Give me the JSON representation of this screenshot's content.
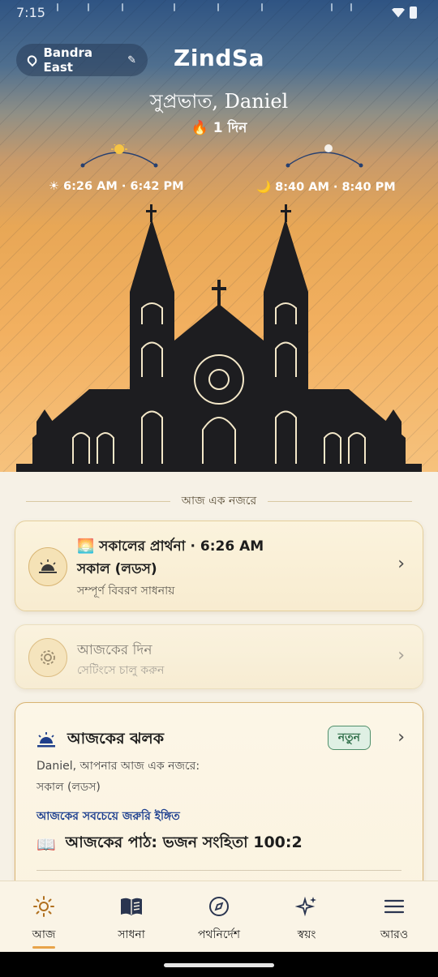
{
  "status_bar": {
    "time": "7:15"
  },
  "header": {
    "location": "Bandra East",
    "app_title": "ZindSa",
    "greeting": "সুপ্রভাত, Daniel",
    "streak": "🔥 1 দিন",
    "sun_times": "☀ 6:26 AM · 6:42 PM",
    "moon_times": "🌙 8:40 AM · 8:40 PM"
  },
  "glance": {
    "title": "আজ এক নজরে"
  },
  "prayer_card": {
    "title": "🌅 সকালের প্রার্থনা · 6:26 AM",
    "name": "সকাল (লডস)",
    "subtitle": "সম্পূর্ণ বিবরণ সাধনায়"
  },
  "today_card": {
    "title": "আজকের দিন",
    "subtitle": "সেটিংসে চালু করুন"
  },
  "insight_card": {
    "title": "আজকের ঝলক",
    "badge": "নতুন",
    "intro": "Daniel, আপনার আজ এক নজরে:",
    "morning": "সকাল (লডস)",
    "hint": "আজকের সবচেয়ে জরুরি ইঙ্গিত",
    "reading": "আজকের পাঠ: ভজন সংহিতা 100:2"
  },
  "nav": [
    {
      "label": "আজ",
      "icon": "sun-icon",
      "active": true
    },
    {
      "label": "সাধনা",
      "icon": "book-icon",
      "active": false
    },
    {
      "label": "পথনির্দেশ",
      "icon": "compass-icon",
      "active": false
    },
    {
      "label": "স্বয়ং",
      "icon": "sparkle-icon",
      "active": false
    },
    {
      "label": "আরও",
      "icon": "menu-icon",
      "active": false
    }
  ],
  "colors": {
    "accent": "#e8a44a",
    "hint_blue": "#1d3f8f",
    "badge_green": "#2e6e48"
  }
}
